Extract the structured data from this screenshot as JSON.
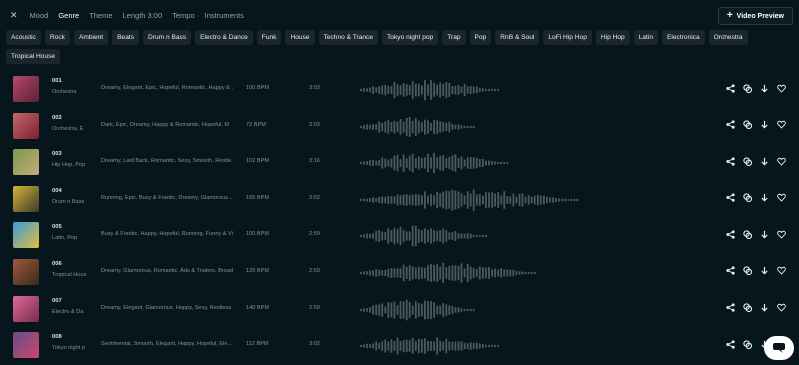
{
  "filters": {
    "tabs": [
      {
        "label": "Mood",
        "active": false
      },
      {
        "label": "Genre",
        "active": true
      },
      {
        "label": "Theme",
        "active": false
      },
      {
        "label": "Length 3:00",
        "active": false
      },
      {
        "label": "Tempo",
        "active": false
      },
      {
        "label": "Instruments",
        "active": false
      }
    ],
    "close_icon": "close-icon"
  },
  "preview_button": {
    "label": "Video Preview",
    "icon": "plus-icon"
  },
  "genres": [
    "Acoustic",
    "Rock",
    "Ambient",
    "Beats",
    "Drum n Bass",
    "Electro & Dance",
    "Funk",
    "House",
    "Techno & Trance",
    "Tokyo night pop",
    "Trap",
    "Pop",
    "RnB & Soul",
    "LoFi Hip Hop",
    "Hip Hop",
    "Latin",
    "Electronica",
    "Orchestra",
    "Tropical House"
  ],
  "tracks": [
    {
      "num": "001",
      "title": "Orchestra",
      "tags": "Dreamy, Elegant, Epic, Hopeful, Romantic, Happy & ...",
      "bpm": "100 BPM",
      "duration": "3:03",
      "thumb_color": "#b64a6a",
      "thumb_color2": "#5a1f36"
    },
    {
      "num": "002",
      "title": "Orchestra, E",
      "tags": "Dark, Epic, Dreamy, Happy & Romantic, Hopeful, M",
      "bpm": "72 BPM",
      "duration": "3:03",
      "thumb_color": "#c26a6a",
      "thumb_color2": "#7a1f2e"
    },
    {
      "num": "003",
      "title": "Hip Hop, Pop",
      "tags": "Dreamy, Laid Back, Romantic, Sexy, Smooth, Restle...",
      "bpm": "102 BPM",
      "duration": "3:16",
      "thumb_color": "#7a9a4a",
      "thumb_color2": "#c8a97a"
    },
    {
      "num": "004",
      "title": "Drum n Bass",
      "tags": "Running, Epic, Busy & Frantic, Dreamy, Glamorous ...",
      "bpm": "165 BPM",
      "duration": "3:02",
      "thumb_color": "#d8b43a",
      "thumb_color2": "#3a3a2a"
    },
    {
      "num": "005",
      "title": "Latin, Pop",
      "tags": "Busy & Frantic, Happy, Hopeful, Running, Funny & Vi",
      "bpm": "100 BPM",
      "duration": "2:59",
      "thumb_color": "#3a9ad8",
      "thumb_color2": "#e0c040"
    },
    {
      "num": "006",
      "title": "Tropical Hous",
      "tags": "Dreamy, Glamorous, Romantic, Ads & Trailers, Broad...",
      "bpm": "120 BPM",
      "duration": "2:59",
      "thumb_color": "#a05a3a",
      "thumb_color2": "#3a2a1a"
    },
    {
      "num": "007",
      "title": "Electro & Da",
      "tags": "Dreamy, Elegant, Glamorous, Happy, Sexy, Restless",
      "bpm": "140 BPM",
      "duration": "2:59",
      "thumb_color": "#e06a9a",
      "thumb_color2": "#7a2a4a"
    },
    {
      "num": "008",
      "title": "Tokyo night p",
      "tags": "Sentimental, Smooth, Elegant, Happy, Hopeful, Ele...",
      "bpm": "112 BPM",
      "duration": "3:02",
      "thumb_color": "#6a4a8a",
      "thumb_color2": "#c84a6a"
    }
  ],
  "row_actions": [
    "share-icon",
    "copy-icon",
    "download-icon",
    "heart-icon"
  ],
  "chat_button": {
    "icon": "chat-icon"
  },
  "colors": {
    "background": "#07161c",
    "chip": "#1a262b",
    "waveform": "#4b5a60"
  }
}
